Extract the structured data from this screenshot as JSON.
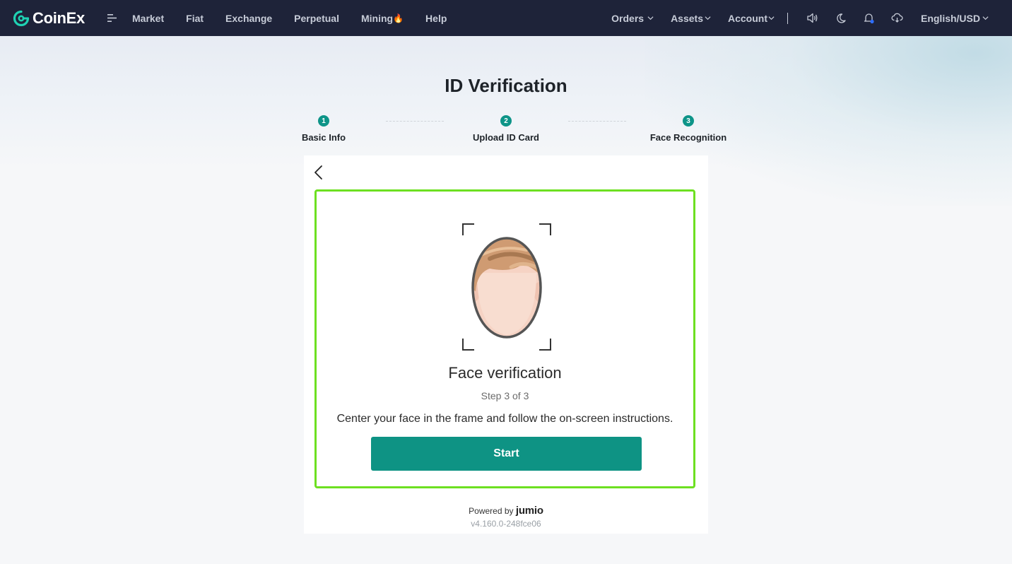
{
  "brand": {
    "name": "CoinEx",
    "accent": "#1fd2b3"
  },
  "nav": {
    "items": [
      "Market",
      "Fiat",
      "Exchange",
      "Perpetual",
      "Mining",
      "Help"
    ],
    "mining_badge": "🔥",
    "orders": "Orders",
    "assets": "Assets",
    "account": "Account",
    "language": "English/USD"
  },
  "page": {
    "title": "ID Verification"
  },
  "steps": [
    {
      "num": "1",
      "label": "Basic Info"
    },
    {
      "num": "2",
      "label": "Upload ID Card"
    },
    {
      "num": "3",
      "label": "Face Recognition"
    }
  ],
  "verification": {
    "title": "Face verification",
    "step_text": "Step 3 of 3",
    "description": "Center your face in the frame and follow the on-screen instructions.",
    "start_label": "Start",
    "powered_by": "Powered by",
    "provider": "jumio",
    "version": "v4.160.0-248fce06",
    "border_color": "#6de021",
    "button_color": "#0e9384"
  },
  "icons": [
    "menu-icon",
    "speaker-icon",
    "moon-icon",
    "bell-icon",
    "download-icon",
    "back-arrow-icon"
  ]
}
